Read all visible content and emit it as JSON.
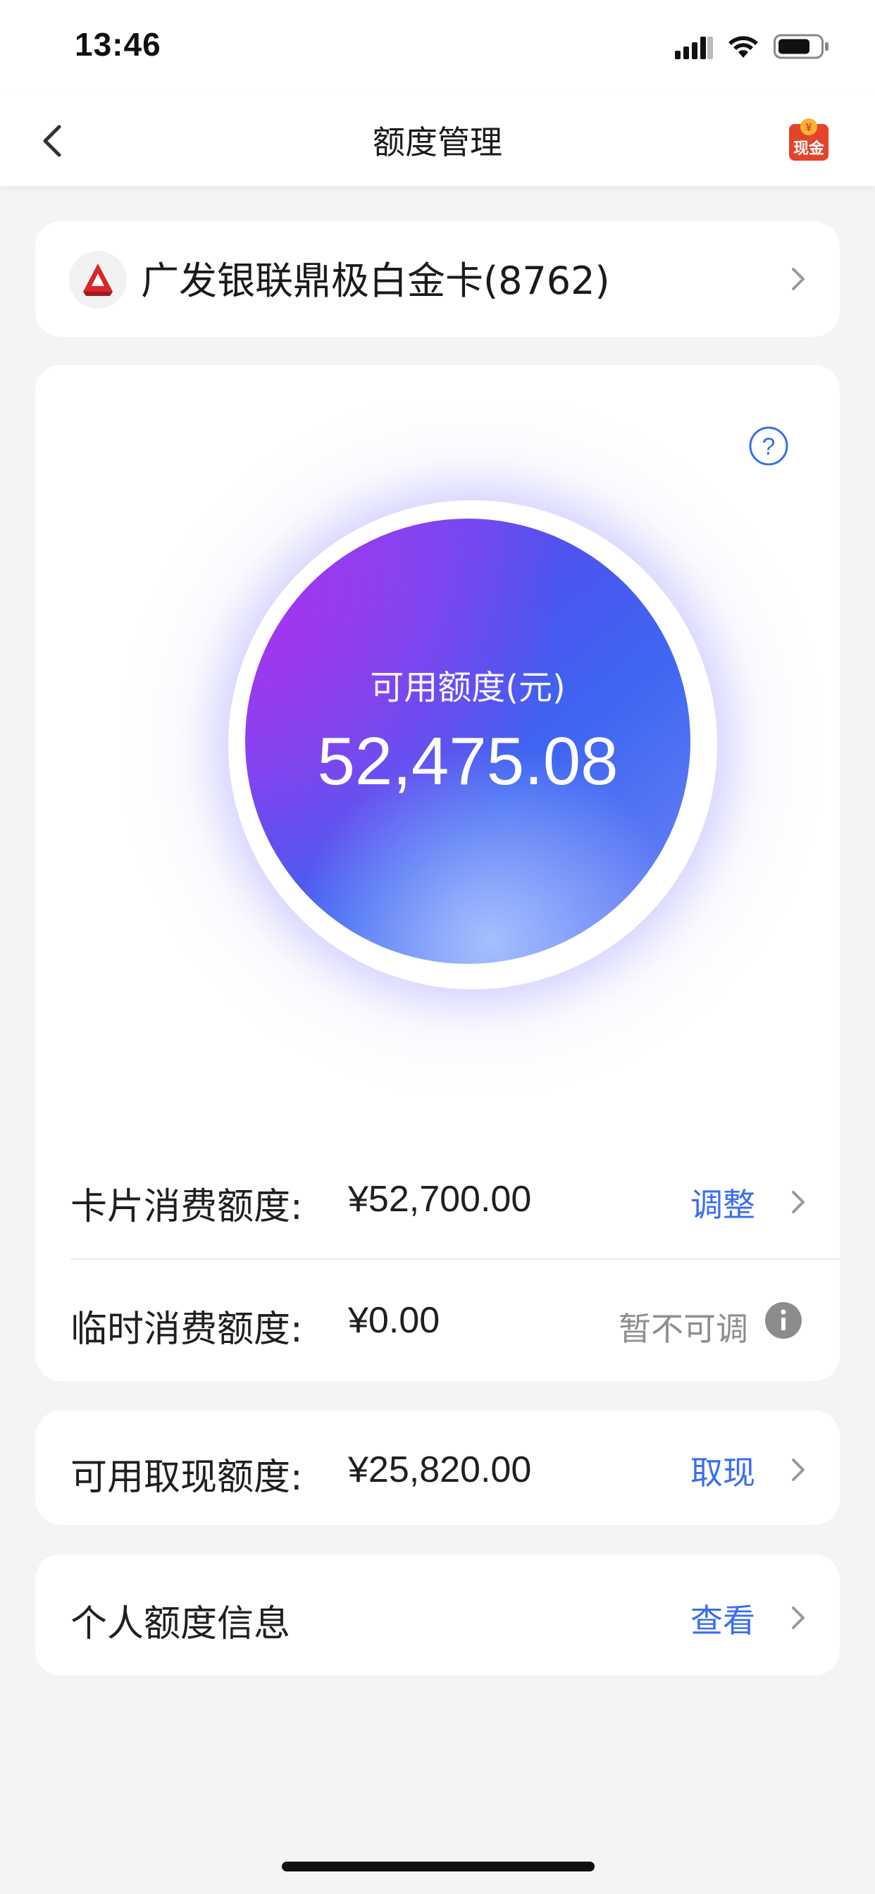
{
  "status_bar": {
    "time": "13:46"
  },
  "nav": {
    "title": "额度管理",
    "cash_badge_top": "¥",
    "cash_badge_text": "现金"
  },
  "account": {
    "name": "广发银联鼎极白金卡(8762)"
  },
  "credit": {
    "available_label": "可用额度(元)",
    "available_value": "52,475.08",
    "card_limit_label": "卡片消费额度:",
    "card_limit_value": "¥52,700.00",
    "card_limit_action": "调整",
    "temp_limit_label": "临时消费额度:",
    "temp_limit_value": "¥0.00",
    "temp_limit_status": "暂不可调"
  },
  "cash": {
    "label": "可用取现额度:",
    "value": "¥25,820.00",
    "action": "取现"
  },
  "personal": {
    "label": "个人额度信息",
    "action": "查看"
  },
  "colors": {
    "accent": "#3a6df0",
    "brand_red": "#d8262b",
    "orb_purple": "#a633f0",
    "orb_blue": "#3f66f2"
  },
  "icons": [
    "back-icon",
    "cash-icon",
    "bank-logo-icon",
    "chevron-right-icon",
    "help-icon",
    "info-icon",
    "signal-icon",
    "wifi-icon",
    "battery-icon"
  ]
}
